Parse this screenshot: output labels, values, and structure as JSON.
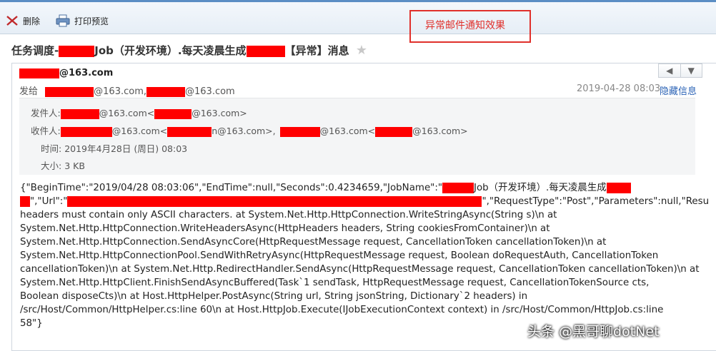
{
  "toolbar": {
    "delete_label": "删除",
    "print_label": "打印预览"
  },
  "annotation": {
    "text": "异常邮件通知效果"
  },
  "subject": {
    "part1": "任务调度-",
    "part2": "Job（开发环境）.每天凌晨生成",
    "part3": "【异常】消息"
  },
  "header": {
    "from": "@163.com",
    "to_label": "发给",
    "to_addr1": "@163.com,",
    "to_addr2": "@163.com",
    "date": "2019-04-28 08:03",
    "hide_link": "隐藏信息"
  },
  "details": {
    "sender_label": "发件人:",
    "sender_a": "@163.com<",
    "sender_b": "@163.com>",
    "recipient_label": "收件人:",
    "rcp_a": "@163.com<",
    "rcp_b": "n@163.com>,",
    "rcp_c": "@163.com<",
    "rcp_d": "@163.com>",
    "time_label": "时间:",
    "time_value": "2019年4月28日 (周日) 08:03",
    "size_label": "大小:",
    "size_value": "3 KB"
  },
  "body": {
    "line1a": "{\"BeginTime\":\"2019/04/28 08:03:06\",\"EndTime\":null,\"Seconds\":0.4234659,\"JobName\":\"",
    "line1b": "Job（开发环境）.每天凌晨生成",
    "line2a": "\",\"Url\":\"",
    "line2b": "\",\"RequestType\":\"Post\",\"Parameters\":null,\"Resu",
    "line3": "headers must contain only ASCII characters. at System.Net.Http.HttpConnection.WriteStringAsync(String s)\\n at",
    "line4": "System.Net.Http.HttpConnection.WriteHeadersAsync(HttpHeaders headers, String cookiesFromContainer)\\n at",
    "line5": "System.Net.Http.HttpConnection.SendAsyncCore(HttpRequestMessage request, CancellationToken cancellationToken)\\n at",
    "line6": "System.Net.Http.HttpConnectionPool.SendWithRetryAsync(HttpRequestMessage request, Boolean doRequestAuth, CancellationToken",
    "line7": "cancellationToken)\\n at System.Net.Http.RedirectHandler.SendAsync(HttpRequestMessage request, CancellationToken cancellationToken)\\n at",
    "line8": "System.Net.Http.HttpClient.FinishSendAsyncBuffered(Task`1 sendTask, HttpRequestMessage request, CancellationTokenSource cts,",
    "line9": "Boolean disposeCts)\\n at Host.HttpHelper.PostAsync(String url, String jsonString, Dictionary`2 headers) in",
    "line10": "/src/Host/Common/HttpHelper.cs:line 60\\n at Host.HttpJob.Execute(IJobExecutionContext context) in /src/Host/Common/HttpJob.cs:line",
    "line11": "58\"}"
  },
  "watermark": "头条 @黑哥聊dotNet",
  "colors": {
    "redaction": "#ff0000",
    "annotation": "#e0302b",
    "link": "#2a62b5"
  }
}
